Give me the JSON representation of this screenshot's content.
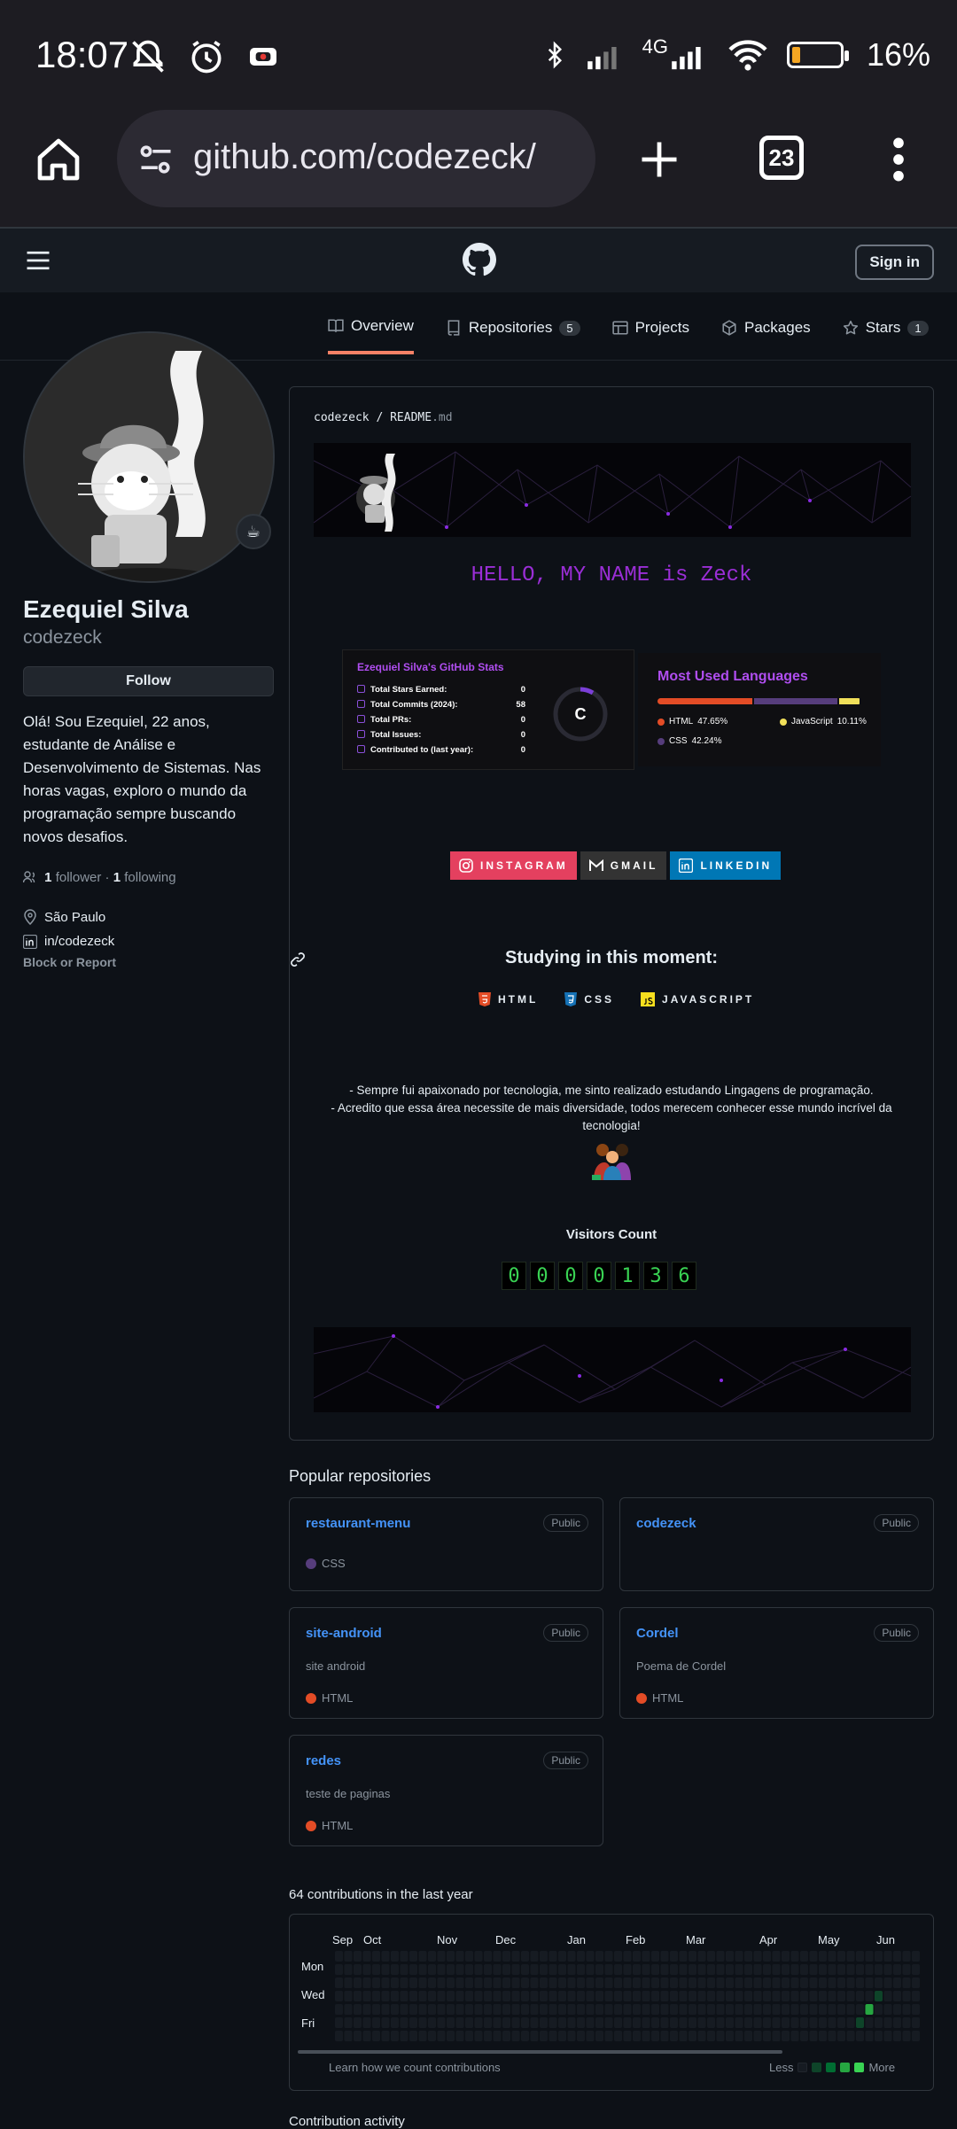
{
  "status_bar": {
    "time": "18:07",
    "network": "4G",
    "battery": "16%",
    "battery_level": 0.16
  },
  "browser": {
    "url": "github.com/codezeck/",
    "tab_count": "23"
  },
  "github_header": {
    "signin": "Sign in"
  },
  "tabs": [
    {
      "label": "Overview"
    },
    {
      "label": "Repositories",
      "count": "5"
    },
    {
      "label": "Projects"
    },
    {
      "label": "Packages"
    },
    {
      "label": "Stars",
      "count": "1"
    }
  ],
  "profile": {
    "name": "Ezequiel Silva",
    "login": "codezeck",
    "follow": "Follow",
    "bio": "Olá! Sou Ezequiel, 22 anos, estudante de Análise e Desenvolvimento de Sistemas. Nas horas vagas, exploro o mundo da programação sempre buscando novos desafios.",
    "followers_count": "1",
    "followers_label": "follower",
    "following_count": "1",
    "following_label": "following",
    "location": "São Paulo",
    "linkedin": "in/codezeck",
    "block": "Block or Report"
  },
  "readme": {
    "path_user": "codezeck",
    "path_file": "README",
    "path_ext": ".md",
    "hello": "HELLO, MY NAME is Zeck",
    "stats": {
      "title": "Ezequiel Silva's GitHub Stats",
      "rows": [
        {
          "label": "Total Stars Earned:",
          "value": "0"
        },
        {
          "label": "Total Commits (2024):",
          "value": "58"
        },
        {
          "label": "Total PRs:",
          "value": "0"
        },
        {
          "label": "Total Issues:",
          "value": "0"
        },
        {
          "label": "Contributed to (last year):",
          "value": "0"
        }
      ],
      "grade": "C"
    },
    "languages": {
      "title": "Most Used Languages",
      "items": [
        {
          "name": "HTML",
          "percent": "47.65%",
          "value": 47.65,
          "color": "#e34c26"
        },
        {
          "name": "JavaScript",
          "percent": "10.11%",
          "value": 10.11,
          "color": "#f1e05a"
        },
        {
          "name": "CSS",
          "percent": "42.24%",
          "value": 42.24,
          "color": "#563d7c"
        }
      ]
    },
    "badges": [
      {
        "label": "INSTAGRAM",
        "color": "#e4405f",
        "icon": "instagram-icon"
      },
      {
        "label": "GMAIL",
        "color": "#333333",
        "icon": "gmail-icon"
      },
      {
        "label": "LINKEDIN",
        "color": "#0077b5",
        "icon": "linkedin-icon"
      }
    ],
    "studying_title": "Studying in this moment:",
    "studying": [
      {
        "label": "HTML",
        "color": "#e34c26"
      },
      {
        "label": "CSS",
        "color": "#1572b6"
      },
      {
        "label": "JAVASCRIPT",
        "color": "#f7df1e"
      }
    ],
    "about_lines": [
      "- Sempre fui apaixonado por tecnologia, me sinto realizado estudando Lingagens de programação.",
      "- Acredito que essa área necessite de mais diversidade, todos merecem conhecer esse mundo incrível da tecnologia!"
    ],
    "visitors_title": "Visitors Count",
    "visitors_digits": [
      "0",
      "0",
      "0",
      "0",
      "1",
      "3",
      "6"
    ]
  },
  "popular": {
    "title": "Popular repositories",
    "repos": [
      {
        "name": "restaurant-menu",
        "visibility": "Public",
        "description": "",
        "language": "CSS",
        "lang_color": "#563d7c"
      },
      {
        "name": "codezeck",
        "visibility": "Public",
        "description": "",
        "language": "",
        "lang_color": ""
      },
      {
        "name": "site-android",
        "visibility": "Public",
        "description": "site android",
        "language": "HTML",
        "lang_color": "#e34c26"
      },
      {
        "name": "Cordel",
        "visibility": "Public",
        "description": "Poema de Cordel",
        "language": "HTML",
        "lang_color": "#e34c26"
      },
      {
        "name": "redes",
        "visibility": "Public",
        "description": "teste de paginas",
        "language": "HTML",
        "lang_color": "#e34c26"
      }
    ]
  },
  "contributions": {
    "title": "64 contributions in the last year",
    "months": [
      "Sep",
      "Oct",
      "Nov",
      "Dec",
      "Jan",
      "Feb",
      "Mar",
      "Apr",
      "May",
      "Jun"
    ],
    "days": [
      "Mon",
      "Wed",
      "Fri"
    ],
    "learn": "Learn how we count contributions",
    "less": "Less",
    "more": "More"
  },
  "activity_title": "Contribution activity"
}
